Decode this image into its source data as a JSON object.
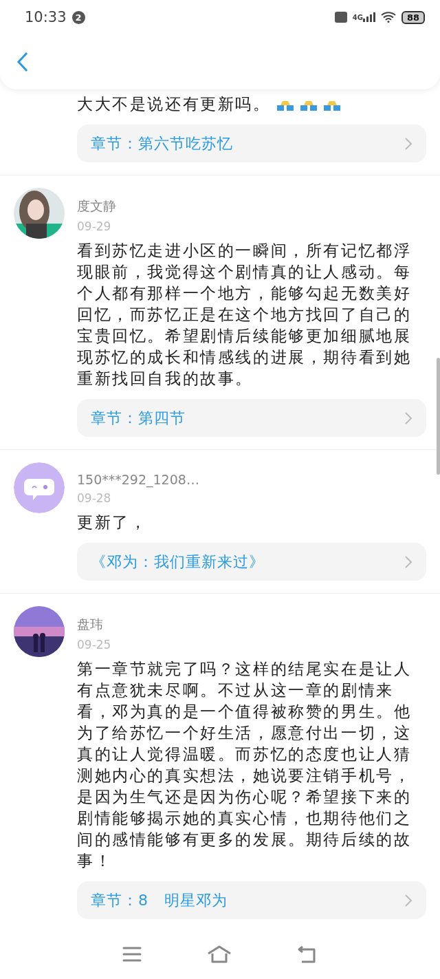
{
  "status_bar": {
    "time": "10:33",
    "notification_count": "2",
    "network": "4G",
    "battery": "88"
  },
  "partial_comment": {
    "text": "大大不是说还有更新吗。",
    "chapter": "章节：第六节吃苏忆"
  },
  "comments": [
    {
      "name": "度文静",
      "date": "09-29",
      "text": "看到苏忆走进小区的一瞬间，所有记忆都浮现眼前，我觉得这个剧情真的让人感动。每个人都有那样一个地方，能够勾起无数美好回忆，而苏忆正是在这个地方找回了自己的宝贵回忆。希望剧情后续能够更加细腻地展现苏忆的成长和情感线的进展，期待看到她重新找回自我的故事。",
      "chapter": "章节：第四节"
    },
    {
      "avatar": {
        "kind": "bubble"
      },
      "name": "150***292_1208…",
      "date": "09-28",
      "text": "更新了，",
      "chapter": "《邓为：我们重新来过》"
    },
    {
      "name": "盘玮",
      "date": "09-25",
      "text": "第一章节就完了吗？这样的结尾实在是让人有点意犹未尽啊。不过从这一章的剧情来看，邓为真的是一个值得被称赞的男生。他为了给苏忆一个好生活，愿意付出一切，这真的让人觉得温暖。而苏忆的态度也让人猜测她内心的真实想法，她说要注销手机号，是因为生气还是因为伤心呢？希望接下来的剧情能够揭示她的真实心情，也期待他们之间的感情能够有更多的发展。期待后续的故事！",
      "chapter": "章节：8　明星邓为"
    }
  ]
}
